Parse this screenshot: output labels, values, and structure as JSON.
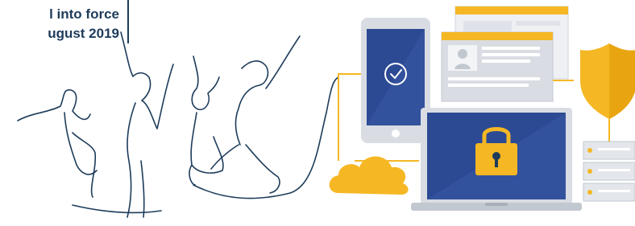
{
  "caption": {
    "line1": "l into force",
    "line2": "ugust 2019"
  },
  "colors": {
    "navy": "#1d3c5a",
    "blue": "#2c4a93",
    "gold": "#f5b724",
    "light_gray": "#d9dde3",
    "white": "#ffffff"
  },
  "icons": [
    "people-line-art",
    "tablet-check",
    "browser-window",
    "id-card-window",
    "shield-icon",
    "laptop-lock",
    "cloud-icon",
    "server-icon"
  ]
}
